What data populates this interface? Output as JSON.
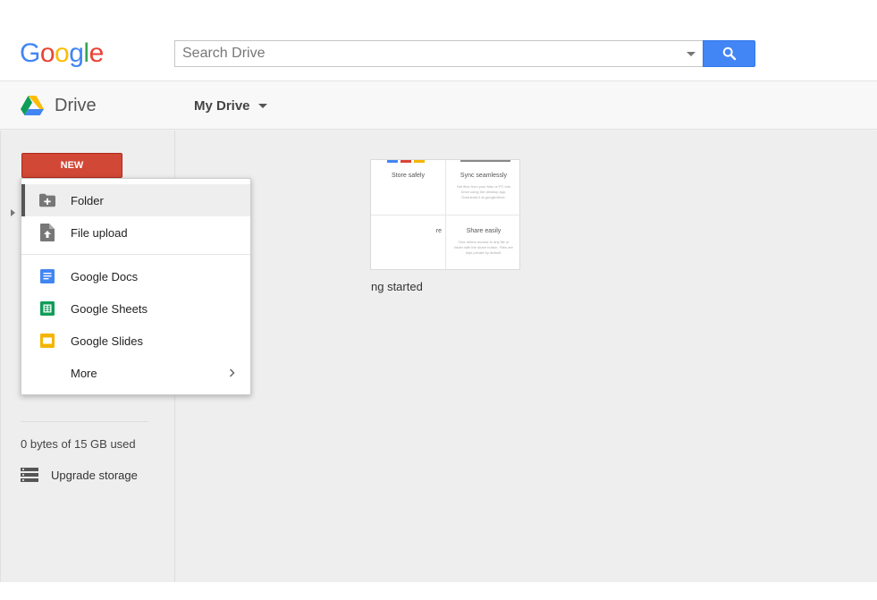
{
  "header": {
    "logo_letters": [
      "G",
      "o",
      "o",
      "g",
      "l",
      "e"
    ],
    "logo_colors": [
      "#4285f4",
      "#ea4335",
      "#fbbc05",
      "#4285f4",
      "#34a853",
      "#ea4335"
    ],
    "search_placeholder": "Search Drive",
    "search_button_color": "#4285f4"
  },
  "appbar": {
    "product_name": "Drive",
    "location": "My Drive"
  },
  "sidebar": {
    "new_button_label": "NEW",
    "new_button_color": "#d14836",
    "storage_text": "0 bytes of 15 GB used",
    "upgrade_label": "Upgrade storage"
  },
  "new_menu": {
    "items": [
      {
        "label": "Folder",
        "icon": "folder-plus-icon"
      },
      {
        "label": "File upload",
        "icon": "file-upload-icon"
      },
      {
        "label": "Google Docs",
        "icon": "google-docs-icon",
        "color": "#4285f4"
      },
      {
        "label": "Google Sheets",
        "icon": "google-sheets-icon",
        "color": "#0f9d58"
      },
      {
        "label": "Google Slides",
        "icon": "google-slides-icon",
        "color": "#f4b400"
      },
      {
        "label": "More",
        "icon": "chevron-right-icon"
      }
    ]
  },
  "files": {
    "card_label": "ng started",
    "preview": {
      "q1_title": "Store safely",
      "q2_title": "Sync seamlessly",
      "q2_desc": "Get files from your Mac or PC into Drive using the desktop app. Download it at google/drive.",
      "q3_title": "re",
      "q4_title": "Share easily",
      "q4_desc": "Give others access to any file or folder with the share button. Files are kept private by default."
    }
  }
}
